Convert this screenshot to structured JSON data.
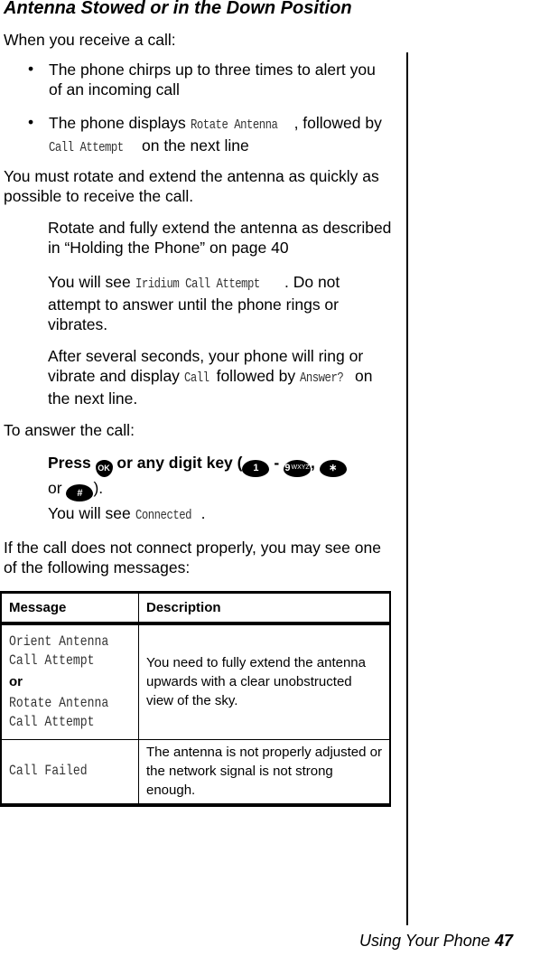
{
  "heading": "Antenna Stowed or in the Down Position",
  "intro": "When you receive a call:",
  "bullets": [
    {
      "text": "The phone chirps up to three times to alert you of an incoming call"
    },
    {
      "pre": "The phone displays ",
      "lcd1": "Rotate Antenna",
      "mid": ", followed by ",
      "lcd2": "Call Attempt",
      "post": " on the next line"
    }
  ],
  "must_rotate": "You must rotate and extend the antenna as quickly as possible to receive the call.",
  "step1": "Rotate and fully extend the antenna as described in “Holding the Phone” on page 40",
  "step2": {
    "pre": "You will see ",
    "lcd": "Iridium Call Attempt",
    "post": ". Do not attempt to answer until the phone rings or vibrates."
  },
  "step3": {
    "pre": "After several seconds, your phone will ring or vibrate and display ",
    "lcd1": "Call",
    "mid": " followed by ",
    "lcd2": "Answer?",
    "post": " on the next line."
  },
  "to_answer": "To answer the call:",
  "press": {
    "pre": "Press ",
    "key_ok": "OK",
    "mid": " or any digit key (",
    "key_1": "1",
    "dash": " - ",
    "key_9": "9",
    "key_9_letters": "WXYZ",
    "comma": ", ",
    "key_star": "∗",
    "or": "or ",
    "key_hash": "#",
    "post": ")."
  },
  "connected": {
    "pre": "You will see ",
    "lcd": "Connected",
    "post": "."
  },
  "if_not_connect": "If the call does not connect properly, you may see one of the following messages:",
  "table": {
    "headers": [
      "Message",
      "Description"
    ],
    "rows": [
      {
        "msg_lines_a": [
          "Orient Antenna",
          "Call Attempt"
        ],
        "or": "or",
        "msg_lines_b": [
          "Rotate Antenna",
          "Call Attempt"
        ],
        "description": "You need to fully extend the antenna upwards with a clear unobstructed view of the sky."
      },
      {
        "msg": "Call Failed",
        "description": "The antenna is not properly adjusted or the network signal is not strong enough."
      }
    ]
  },
  "footer": {
    "section": "Using Your Phone",
    "page": "47"
  }
}
